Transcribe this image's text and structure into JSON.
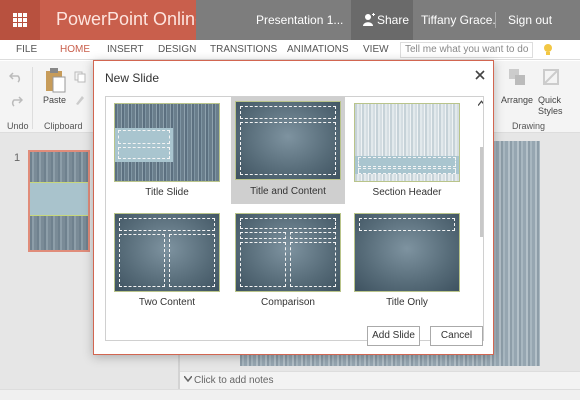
{
  "topbar": {
    "app_title": "PowerPoint Online",
    "doc_title": "Presentation 1...",
    "share_label": "Share",
    "user_name": "Tiffany Grace...",
    "signout_label": "Sign out",
    "accent_color": "#c95f4c"
  },
  "ribbon": {
    "tabs": [
      {
        "label": "FILE"
      },
      {
        "label": "HOME",
        "active": true
      },
      {
        "label": "INSERT"
      },
      {
        "label": "DESIGN"
      },
      {
        "label": "TRANSITIONS"
      },
      {
        "label": "ANIMATIONS"
      },
      {
        "label": "VIEW"
      }
    ],
    "tell_me_placeholder": "Tell me what you want to do",
    "paste_label": "Paste",
    "undo_group": "Undo",
    "clipboard_group": "Clipboard",
    "drawing_group": "Drawing",
    "arrange_label": "Arrange",
    "quick_styles_label": "Quick Styles"
  },
  "slides_panel": {
    "slide_number": "1"
  },
  "notes": {
    "placeholder": "Click to add notes"
  },
  "dialog": {
    "title": "New Slide",
    "layouts": [
      {
        "label": "Title Slide",
        "selected": false
      },
      {
        "label": "Title and Content",
        "selected": true
      },
      {
        "label": "Section Header",
        "selected": false
      },
      {
        "label": "Two Content",
        "selected": false
      },
      {
        "label": "Comparison",
        "selected": false
      },
      {
        "label": "Title Only",
        "selected": false
      }
    ],
    "add_button": "Add Slide",
    "cancel_button": "Cancel"
  }
}
